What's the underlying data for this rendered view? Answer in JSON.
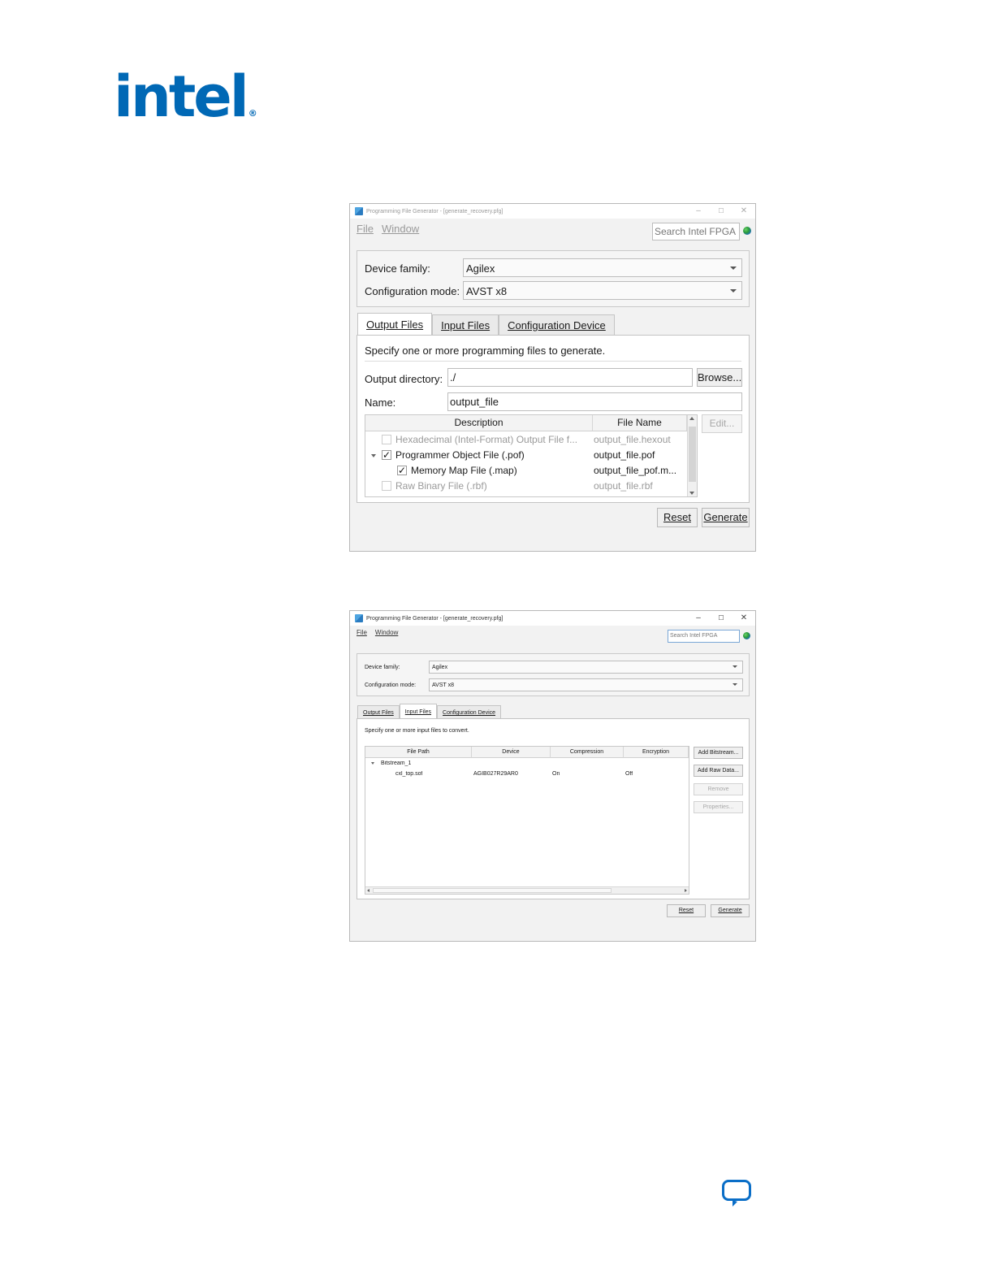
{
  "brand": {
    "logo_text": "intel",
    "reg_mark": "®",
    "color": "#0068b5"
  },
  "window1": {
    "title": "Programming File Generator - [generate_recovery.pfg]",
    "controls": {
      "minimize": "–",
      "maximize": "☐",
      "close": "✕"
    },
    "menu": {
      "file": "File",
      "window": "Window"
    },
    "search_placeholder": "Search Intel FPGA",
    "device_family_label": "Device family:",
    "device_family_value": "Agilex",
    "config_mode_label": "Configuration mode:",
    "config_mode_value": "AVST x8",
    "tabs": [
      "Output Files",
      "Input Files",
      "Configuration Device"
    ],
    "active_tab": "Output Files",
    "instructions": "Specify one or more programming files to generate.",
    "output_dir_label": "Output directory:",
    "output_dir_value": "./",
    "browse_button": "Browse...",
    "name_label": "Name:",
    "name_value": "output_file",
    "table_headers": [
      "Description",
      "File Name"
    ],
    "rows": [
      {
        "description": "Hexadecimal (Intel-Format) Output File f...",
        "file_name": "output_file.hexout",
        "checked": false,
        "enabled": false
      },
      {
        "description": "Programmer Object File (.pof)",
        "file_name": "output_file.pof",
        "checked": true,
        "enabled": true,
        "expanded": true
      },
      {
        "description": "Memory Map File (.map)",
        "file_name": "output_file_pof.m...",
        "checked": true,
        "enabled": true
      },
      {
        "description": "Raw Binary File (.rbf)",
        "file_name": "output_file.rbf",
        "checked": false,
        "enabled": false
      }
    ],
    "edit_button": "Edit...",
    "reset_button": "Reset",
    "generate_button": "Generate"
  },
  "window2": {
    "title": "Programming File Generator - [generate_recovery.pfg]",
    "controls": {
      "minimize": "–",
      "maximize": "☐",
      "close": "✕"
    },
    "menu": {
      "file": "File",
      "window": "Window"
    },
    "search_placeholder": "Search Intel FPGA",
    "device_family_label": "Device family:",
    "device_family_value": "Agilex",
    "config_mode_label": "Configuration mode:",
    "config_mode_value": "AVST x8",
    "tabs": [
      "Output Files",
      "Input Files",
      "Configuration Device"
    ],
    "active_tab": "Input Files",
    "instructions": "Specify one or more input files to convert.",
    "table_headers": [
      "File Path",
      "Device",
      "Compression",
      "Encryption"
    ],
    "tree": {
      "bitstream": "Bitstream_1",
      "file": {
        "path": "cxl_top.sof",
        "device": "AGIB027R29AR0",
        "compression": "On",
        "encryption": "Off"
      }
    },
    "side_buttons": {
      "add_bitstream": "Add Bitstream...",
      "add_raw_data": "Add Raw Data...",
      "remove": "Remove",
      "properties": "Properties..."
    },
    "reset_button": "Reset",
    "generate_button": "Generate"
  },
  "feedback_icon": "chat-bubble-icon"
}
